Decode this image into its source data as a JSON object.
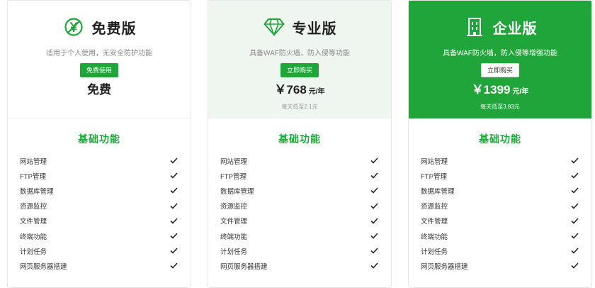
{
  "plans": [
    {
      "name": "免费版",
      "icon": "no-money-icon",
      "description": "适用于个人使用，无安全防护功能",
      "button_label": "免费使用",
      "price_text": "免费"
    },
    {
      "name": "专业版",
      "icon": "diamond-icon",
      "description": "具备WAF防火墙，防入侵等功能",
      "button_label": "立即购买",
      "price": "￥768",
      "price_unit": "元/年",
      "daily_note": "每天低至2.1元"
    },
    {
      "name": "企业版",
      "icon": "building-icon",
      "description": "具备WAF防火墙，防入侵等增强功能",
      "button_label": "立即购买",
      "price": "￥1399",
      "price_unit": "元/年",
      "daily_note": "每天低至3.83元"
    }
  ],
  "features_title": "基础功能",
  "features": [
    "网站管理",
    "FTP管理",
    "数据库管理",
    "资源监控",
    "文件管理",
    "终端功能",
    "计划任务",
    "网页服务器搭建"
  ],
  "colors": {
    "accent": "#20a53a",
    "pro_header_bg": "#eef6ef"
  }
}
